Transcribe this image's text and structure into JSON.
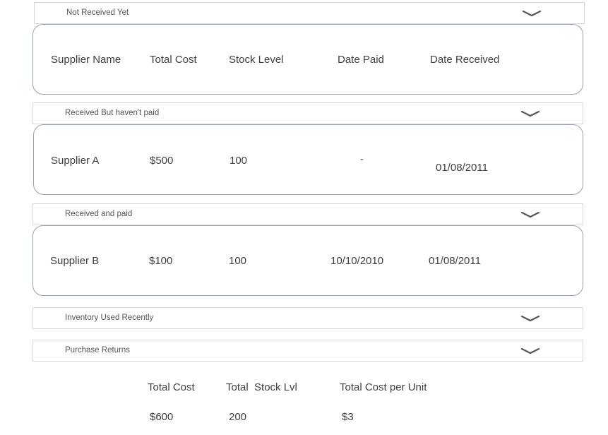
{
  "sections": {
    "not_received": {
      "label": "Not Received Yet"
    },
    "received_not_paid": {
      "label": "Received But haven't paid"
    },
    "received_paid": {
      "label": "Received and paid"
    },
    "inventory_used": {
      "label": "Inventory Used Recently"
    },
    "purchase_returns": {
      "label": "Purchase Returns"
    }
  },
  "columns": {
    "supplier_name": "Supplier Name",
    "total_cost": "Total Cost",
    "stock_level": "Stock Level",
    "date_paid": "Date Paid",
    "date_received": "Date Received"
  },
  "rows": {
    "supplier_a": {
      "name": "Supplier A",
      "total_cost": "$500",
      "stock_level": "100",
      "date_paid": "-",
      "date_received": "01/08/2011"
    },
    "supplier_b": {
      "name": "Supplier B",
      "total_cost": "$100",
      "stock_level": "100",
      "date_paid": "10/10/2010",
      "date_received": "01/08/2011"
    }
  },
  "totals": {
    "headers": {
      "total_cost": "Total Cost",
      "total_stock": "Total  Stock Lvl",
      "cost_per_unit": "Total Cost per Unit"
    },
    "values": {
      "total_cost": "$600",
      "total_stock": "200",
      "cost_per_unit": "$3"
    }
  },
  "icons": {
    "expand": "chevron-down-icon"
  },
  "colors": {
    "card_border": "#9aa3ad",
    "header_border": "#d7d7d7",
    "chevron": "#555555"
  }
}
